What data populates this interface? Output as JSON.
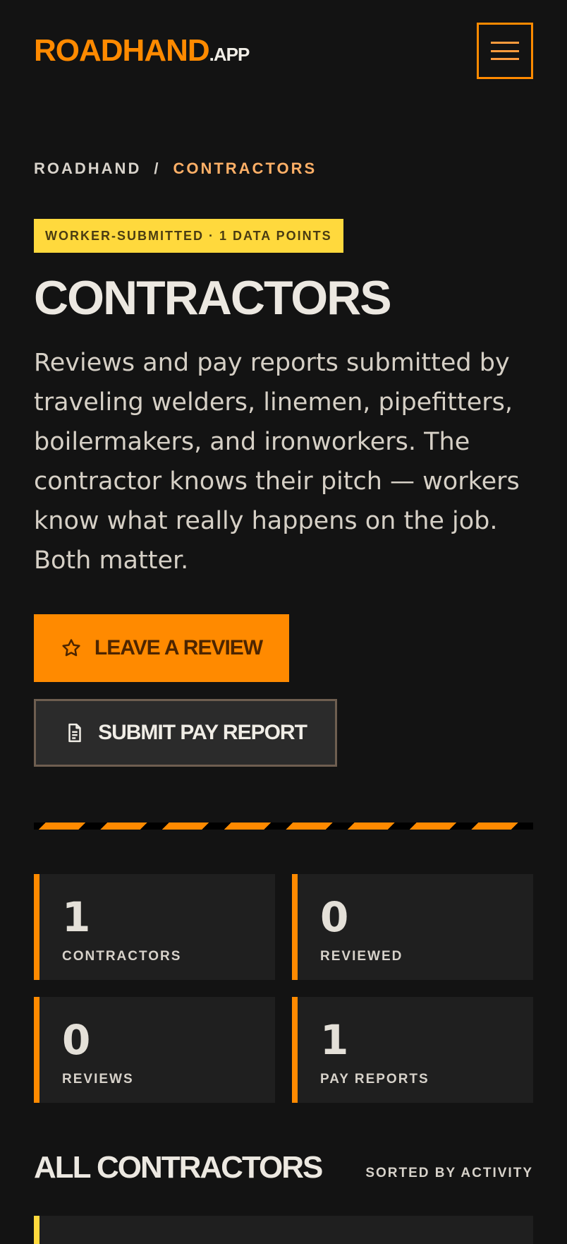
{
  "header": {
    "logo_main": "ROADHAND",
    "logo_suffix": ".APP",
    "menu_icon": "hamburger-menu-icon"
  },
  "breadcrumb": {
    "home": "ROADHAND",
    "separator": "/",
    "current": "CONTRACTORS"
  },
  "badge": {
    "text": "WORKER-SUBMITTED · 1 DATA POINTS"
  },
  "page": {
    "title": "CONTRACTORS",
    "description": "Reviews and pay reports submitted by traveling welders, linemen, pipefitters, boilermakers, and ironworkers. The contractor knows their pitch — workers know what really happens on the job. Both matter."
  },
  "actions": {
    "review_label": "LEAVE A REVIEW",
    "review_icon": "star-outline-icon",
    "pay_label": "SUBMIT PAY REPORT",
    "pay_icon": "document-icon"
  },
  "stats": [
    {
      "value": "1",
      "label": "CONTRACTORS"
    },
    {
      "value": "0",
      "label": "REVIEWED"
    },
    {
      "value": "0",
      "label": "REVIEWS"
    },
    {
      "value": "1",
      "label": "PAY REPORTS"
    }
  ],
  "section": {
    "title": "ALL CONTRACTORS",
    "sort": "SORTED BY ACTIVITY"
  },
  "colors": {
    "background": "#131313",
    "accent_orange": "#ff8a00",
    "accent_yellow": "#ffd93d",
    "card": "#1f1f1f",
    "text": "#e8e4dc"
  }
}
